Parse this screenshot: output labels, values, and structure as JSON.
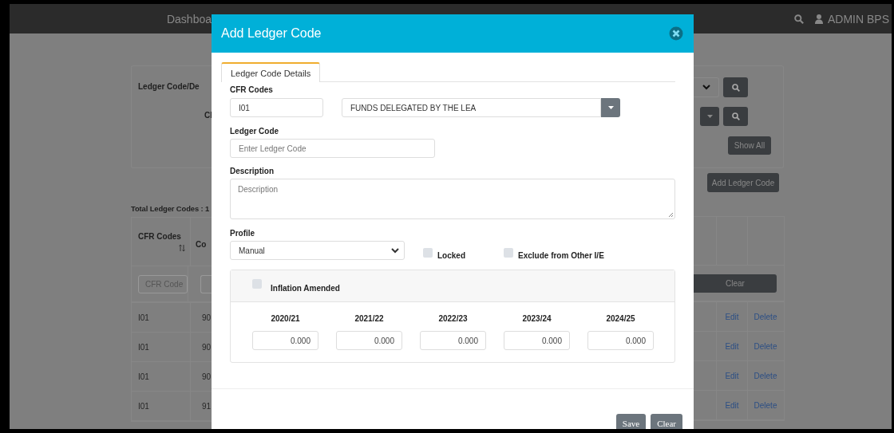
{
  "top_bar": {
    "nav_label": "Dashboa",
    "user": "ADMIN BPS"
  },
  "filters": {
    "labels": [
      "Ledger Code/De",
      "Cl"
    ],
    "show_all": "Show All"
  },
  "add_button": "Add Ledger Code",
  "total": "Total Ledger Codes : 1",
  "table": {
    "columns": [
      "CFR Codes",
      "Co"
    ],
    "filter_placeholder": "CFR Code",
    "clear": "Clear",
    "rows": [
      {
        "cfr": "I01",
        "column_2": "90",
        "edit": "Edit",
        "delete": "Delete"
      },
      {
        "cfr": "I01",
        "column_2": "90",
        "edit": "Edit",
        "delete": "Delete"
      },
      {
        "cfr": "I01",
        "column_2": "90",
        "edit": "Edit",
        "delete": "Delete"
      },
      {
        "cfr": "I01",
        "column_2": "91",
        "edit": "Edit",
        "delete": "Delete"
      }
    ]
  },
  "modal": {
    "title": "Add Ledger Code",
    "tabs": [
      {
        "label": "Ledger Code Details",
        "selected": true
      }
    ],
    "cfr_label": "CFR Codes",
    "cfr_code": "I01",
    "cfr_name": "FUNDS DELEGATED BY THE LEA",
    "ledger_label": "Ledger Code",
    "ledger_placeholder": "Enter Ledger Code",
    "description_label": "Description",
    "description_placeholder": "Description",
    "profile_label": "Profile",
    "profile": "Manual",
    "checks": [
      {
        "label": "Locked",
        "checked": false
      },
      {
        "label": "Exclude from Other I/E",
        "checked": false
      }
    ],
    "inflation": {
      "label": "Inflation Amended",
      "checked": false
    },
    "years": [
      {
        "label": "2020/21",
        "value": "0.000"
      },
      {
        "label": "2021/22",
        "value": "0.000"
      },
      {
        "label": "2022/23",
        "value": "0.000"
      },
      {
        "label": "2023/24",
        "value": "0.000"
      },
      {
        "label": "2024/25",
        "value": "0.000"
      }
    ],
    "buttons": [
      "Save",
      "Clear"
    ]
  }
}
